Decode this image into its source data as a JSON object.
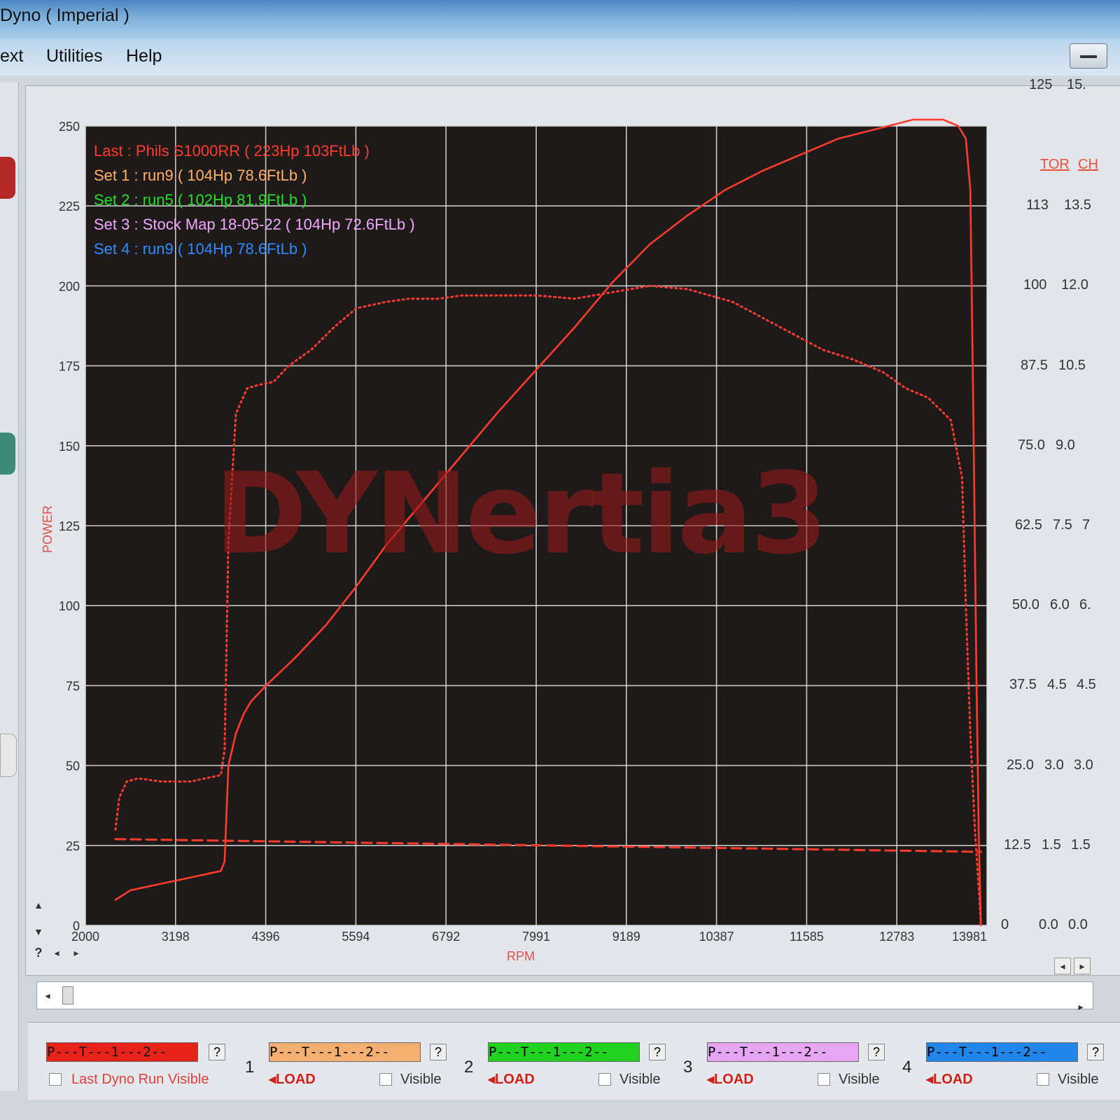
{
  "window": {
    "title": "Dyno ( Imperial )"
  },
  "menu": {
    "items": [
      "ext",
      "Utilities",
      "Help"
    ]
  },
  "watermark": "DYNertia3",
  "chart_data": {
    "type": "line",
    "xlabel": "RPM",
    "ylabel": "POWER",
    "xlim": [
      2000,
      13981
    ],
    "ylim": [
      0,
      250
    ],
    "x_ticks": [
      "2000",
      "3198",
      "4396",
      "5594",
      "6792",
      "7991",
      "9189",
      "10387",
      "11585",
      "12783",
      "13981"
    ],
    "y_ticks": [
      "0",
      "25",
      "50",
      "75",
      "100",
      "125",
      "150",
      "175",
      "200",
      "225",
      "250"
    ],
    "right_axes": [
      {
        "label": "TOR",
        "ticks": [
          "0",
          "12.5",
          "25.0",
          "37.5",
          "50.0",
          "62.5",
          "75.0",
          "87.5",
          "100",
          "113",
          "125"
        ]
      },
      {
        "label": "CH",
        "ticks": [
          "0.0",
          "1.5",
          "3.0",
          "4.5",
          "6.0",
          "7.5",
          "9.0",
          "10.5",
          "12.0",
          "13.5",
          "15."
        ]
      },
      {
        "label": "",
        "ticks": [
          "0.0",
          "1.5",
          "3.0",
          "4.5",
          "6.",
          "7"
        ]
      }
    ],
    "legend": [
      {
        "text": "Last : Phils S1000RR ( 223Hp  103FtLb )",
        "color": "#ff3b2b"
      },
      {
        "text": "Set 1 : run9 ( 104Hp  78.6FtLb )",
        "color": "#ffb066"
      },
      {
        "text": "Set 2 : run5 ( 102Hp  81.9FtLb )",
        "color": "#22e022"
      },
      {
        "text": "Set 3 : Stock Map 18-05-22 ( 104Hp  72.6FtLb )",
        "color": "#f0a8ff"
      },
      {
        "text": "Set 4 : run9 ( 104Hp  78.6FtLb )",
        "color": "#2f8cff"
      }
    ],
    "series": [
      {
        "style": "solid",
        "x": [
          2400,
          2600,
          3000,
          3400,
          3800,
          3850,
          3900,
          4000,
          4100,
          4200,
          4400,
          4800,
          5200,
          5600,
          6000,
          6500,
          7000,
          7500,
          8000,
          8500,
          9000,
          9500,
          10000,
          10500,
          11000,
          11500,
          12000,
          12500,
          13000,
          13400,
          13600,
          13700,
          13760,
          13800,
          13840,
          13870,
          13900
        ],
        "y": [
          8,
          11,
          13,
          15,
          17,
          20,
          50,
          60,
          66,
          70,
          75,
          84,
          94,
          106,
          119,
          133,
          147,
          161,
          174,
          187,
          201,
          213,
          222,
          230,
          236,
          241,
          246,
          249,
          252,
          252,
          250,
          246,
          230,
          160,
          80,
          30,
          0
        ]
      },
      {
        "style": "dotted",
        "x": [
          2400,
          2450,
          2550,
          2700,
          3000,
          3400,
          3800,
          3850,
          3900,
          4000,
          4150,
          4300,
          4500,
          4700,
          5000,
          5300,
          5600,
          6000,
          6300,
          6700,
          7000,
          7500,
          8000,
          8500,
          9000,
          9500,
          10000,
          10300,
          10600,
          11000,
          11400,
          11800,
          12200,
          12600,
          12900,
          13200,
          13500,
          13650,
          13700,
          13760,
          13820,
          13870,
          13900
        ],
        "y": [
          30,
          40,
          45,
          46,
          45,
          45,
          47,
          55,
          120,
          160,
          168,
          169,
          170,
          175,
          180,
          187,
          193,
          195,
          196,
          196,
          197,
          197,
          197,
          196,
          198,
          200,
          199,
          197,
          195,
          190,
          185,
          180,
          177,
          173,
          168,
          165,
          158,
          140,
          100,
          60,
          30,
          12,
          0
        ]
      },
      {
        "style": "dashed",
        "x": [
          2400,
          13900
        ],
        "y": [
          27,
          23
        ]
      }
    ]
  },
  "bottom": {
    "last": {
      "bar": "P---T---1---2--",
      "color": "#e8231a",
      "visible_label": "Last Dyno Run Visible"
    },
    "sets": [
      {
        "num": "1",
        "bar": "P---T---1---2--",
        "color": "#f5b071",
        "load": "LOAD",
        "visible": "Visible"
      },
      {
        "num": "2",
        "bar": "P---T---1---2--",
        "color": "#21d221",
        "load": "LOAD",
        "visible": "Visible"
      },
      {
        "num": "3",
        "bar": "P---T---1---2--",
        "color": "#e7a6f3",
        "load": "LOAD",
        "visible": "Visible"
      },
      {
        "num": "4",
        "bar": "P---T---1---2--",
        "color": "#2186ea",
        "load": "LOAD",
        "visible": "Visible"
      }
    ],
    "help": "?"
  }
}
